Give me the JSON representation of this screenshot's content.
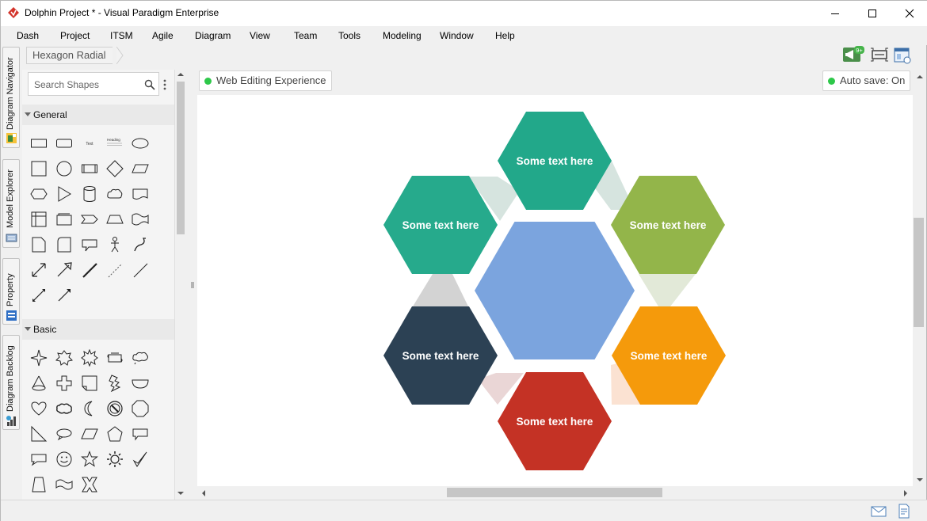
{
  "window": {
    "title": "Dolphin Project * - Visual Paradigm Enterprise"
  },
  "menu": [
    "Dash",
    "Project",
    "ITSM",
    "Agile",
    "Diagram",
    "View",
    "Team",
    "Tools",
    "Modeling",
    "Window",
    "Help"
  ],
  "side_tabs": [
    "Diagram Navigator",
    "Model Explorer",
    "Property",
    "Diagram Backlog"
  ],
  "breadcrumb": "Hexagon Radial",
  "toolbar": {
    "notification_badge": "9+"
  },
  "palette": {
    "search_placeholder": "Search Shapes",
    "sections": [
      {
        "label": "General",
        "shapes": [
          "rectangle",
          "rounded-rectangle",
          "text",
          "heading",
          "ellipse",
          "square",
          "circle",
          "process",
          "diamond",
          "parallelogram",
          "hexagon",
          "triangle",
          "cylinder",
          "cloud",
          "document",
          "table",
          "card",
          "chevron",
          "trapezoid",
          "wave",
          "note",
          "rounded-corner",
          "callout",
          "actor",
          "curve",
          "double-arrow",
          "arrow",
          "thick-line",
          "dashed-line",
          "line",
          "double-headed-arrow",
          "connector"
        ]
      },
      {
        "label": "Basic",
        "shapes": [
          "star-4",
          "star-5-outline",
          "burst",
          "scroll",
          "cloud-callout",
          "cone",
          "cross",
          "folded-corner",
          "lightning",
          "half-circle",
          "heart",
          "cloud-bubble",
          "moon",
          "no-symbol",
          "octagon",
          "right-triangle",
          "ellipse-callout",
          "slanted-rectangle",
          "pentagon",
          "rectangle-callout",
          "speech-callout",
          "smiley",
          "star-5",
          "sun",
          "check",
          "trapezoid-basic",
          "wave-flag",
          "x-shape"
        ]
      }
    ],
    "section_text_samples": {
      "text": "Text",
      "heading": "Heading"
    }
  },
  "canvas": {
    "web_editing_label": "Web Editing Experience",
    "autosave_label": "Auto save: On"
  },
  "diagram": {
    "center_color": "#7ba4de",
    "hexagons": [
      {
        "label": "Some text here",
        "color": "#22a88a",
        "connector_color": "#d6e4df"
      },
      {
        "label": "Some text here",
        "color": "#93b54a",
        "connector_color": "#e2e9d8"
      },
      {
        "label": "Some text here",
        "color": "#f59a0b",
        "connector_color": "#fbe2d2"
      },
      {
        "label": "Some text here",
        "color": "#c43225",
        "connector_color": "#ead6d6"
      },
      {
        "label": "Some text here",
        "color": "#2c4154",
        "connector_color": "#d3d3d3"
      },
      {
        "label": "Some text here",
        "color": "#26aa8c",
        "connector_color": "#d6e4df"
      }
    ]
  }
}
